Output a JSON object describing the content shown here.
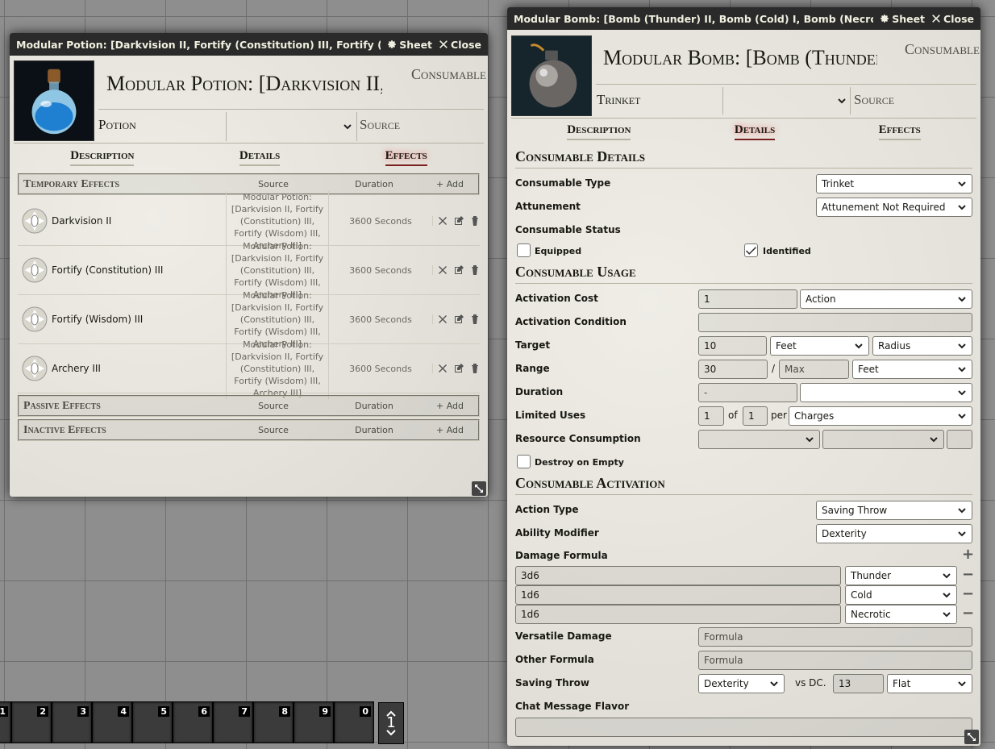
{
  "potion": {
    "title": "Modular Potion: [Darkvision II, Fortify (Constitution) III, Fortify (Wisdom) III,",
    "sheet_label": "Sheet",
    "close_label": "Close",
    "name": "Modular Potion: [Darkvision II, Fortify (Constitution) III, Fortify (Wisdom) III, Archery III]",
    "category": "Consumable",
    "subtype": "Potion",
    "source_label": "Source",
    "tabs": [
      "Description",
      "Details",
      "Effects"
    ],
    "active_tab": "Effects",
    "temp_header": "Temporary Effects",
    "passive_header": "Passive Effects",
    "inactive_header": "Inactive Effects",
    "col_source": "Source",
    "col_duration": "Duration",
    "add_label": "Add",
    "effects": [
      {
        "name": "Darkvision II",
        "source": "Modular Potion: [Darkvision II, Fortify (Constitution) III, Fortify (Wisdom) III, Archery III]",
        "duration": "3600 Seconds"
      },
      {
        "name": "Fortify (Constitution) III",
        "source": "Modular Potion: [Darkvision II, Fortify (Constitution) III, Fortify (Wisdom) III, Archery III]",
        "duration": "3600 Seconds"
      },
      {
        "name": "Fortify (Wisdom) III",
        "source": "Modular Potion: [Darkvision II, Fortify (Constitution) III, Fortify (Wisdom) III, Archery III]",
        "duration": "3600 Seconds"
      },
      {
        "name": "Archery III",
        "source": "Modular Potion: [Darkvision II, Fortify (Constitution) III, Fortify (Wisdom) III, Archery III]",
        "duration": "3600 Seconds"
      }
    ]
  },
  "bomb": {
    "title": "Modular Bomb: [Bomb (Thunder) II, Bomb (Cold) I, Bomb (Necrotic) I]",
    "sheet_label": "Sheet",
    "close_label": "Close",
    "name": "Modular Bomb: [Bomb (Thunder) II, Bomb (Cold) I, Bomb (Necrotic) I]",
    "category": "Consumable",
    "subtype": "Trinket",
    "source_label": "Source",
    "tabs": [
      "Description",
      "Details",
      "Effects"
    ],
    "active_tab": "Details",
    "details": {
      "section": "Consumable Details",
      "type_label": "Consumable Type",
      "type_value": "Trinket",
      "attune_label": "Attunement",
      "attune_value": "Attunement Not Required",
      "status_label": "Consumable Status",
      "equipped_label": "Equipped",
      "equipped": false,
      "identified_label": "Identified",
      "identified": true
    },
    "usage": {
      "section": "Consumable Usage",
      "act_cost_label": "Activation Cost",
      "act_cost_value": "1",
      "act_cost_type": "Action",
      "act_cond_label": "Activation Condition",
      "act_cond_value": "",
      "target_label": "Target",
      "target_value": "10",
      "target_units": "Feet",
      "target_type": "Radius",
      "range_label": "Range",
      "range_value": "30",
      "range_slash": "/",
      "range_max_placeholder": "Max",
      "range_units": "Feet",
      "duration_label": "Duration",
      "duration_value": "-",
      "duration_units": "",
      "uses_label": "Limited Uses",
      "uses_value": "1",
      "uses_of": "of",
      "uses_max": "1",
      "uses_per": "per",
      "uses_period": "Charges",
      "resource_label": "Resource Consumption",
      "destroy_label": "Destroy on Empty",
      "destroy": false
    },
    "activation": {
      "section": "Consumable Activation",
      "action_type_label": "Action Type",
      "action_type_value": "Saving Throw",
      "ability_label": "Ability Modifier",
      "ability_value": "Dexterity",
      "damage_label": "Damage Formula",
      "damage": [
        {
          "formula": "3d6",
          "type": "Thunder"
        },
        {
          "formula": "1d6",
          "type": "Cold"
        },
        {
          "formula": "1d6",
          "type": "Necrotic"
        }
      ],
      "versatile_label": "Versatile Damage",
      "versatile_placeholder": "Formula",
      "other_label": "Other Formula",
      "other_placeholder": "Formula",
      "save_label": "Saving Throw",
      "save_ability": "Dexterity",
      "save_vs": "vs DC.",
      "save_dc": "13",
      "save_scaling": "Flat",
      "flavor_label": "Chat Message Flavor"
    }
  },
  "hotbar": {
    "slots": [
      "1",
      "2",
      "3",
      "4",
      "5",
      "6",
      "7",
      "8",
      "9",
      "0"
    ],
    "page": "1"
  }
}
